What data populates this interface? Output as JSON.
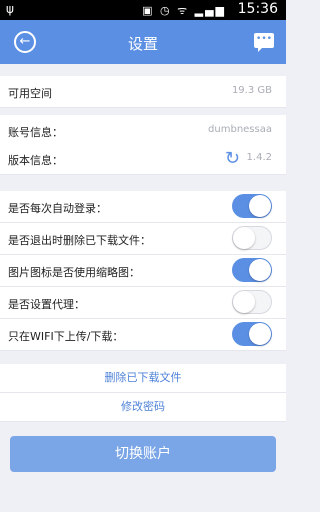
{
  "status": {
    "time": "15:36"
  },
  "header": {
    "title": "设置"
  },
  "storage": {
    "label": "可用空间",
    "value": "19.3 GB"
  },
  "account": {
    "label": "账号信息：",
    "value": "dumbnessaa",
    "version_label": "版本信息：",
    "version_value": "1.4.2"
  },
  "toggles": [
    {
      "label": "是否每次自动登录：",
      "on": true
    },
    {
      "label": "是否退出时删除已下载文件：",
      "on": false
    },
    {
      "label": "图片图标是否使用缩略图：",
      "on": true
    },
    {
      "label": "是否设置代理：",
      "on": false
    },
    {
      "label": "只在WIFI下上传/下载：",
      "on": true
    }
  ],
  "actions": {
    "delete_downloads": "删除已下载文件",
    "change_password": "修改密码",
    "switch_account": "切换账户"
  }
}
